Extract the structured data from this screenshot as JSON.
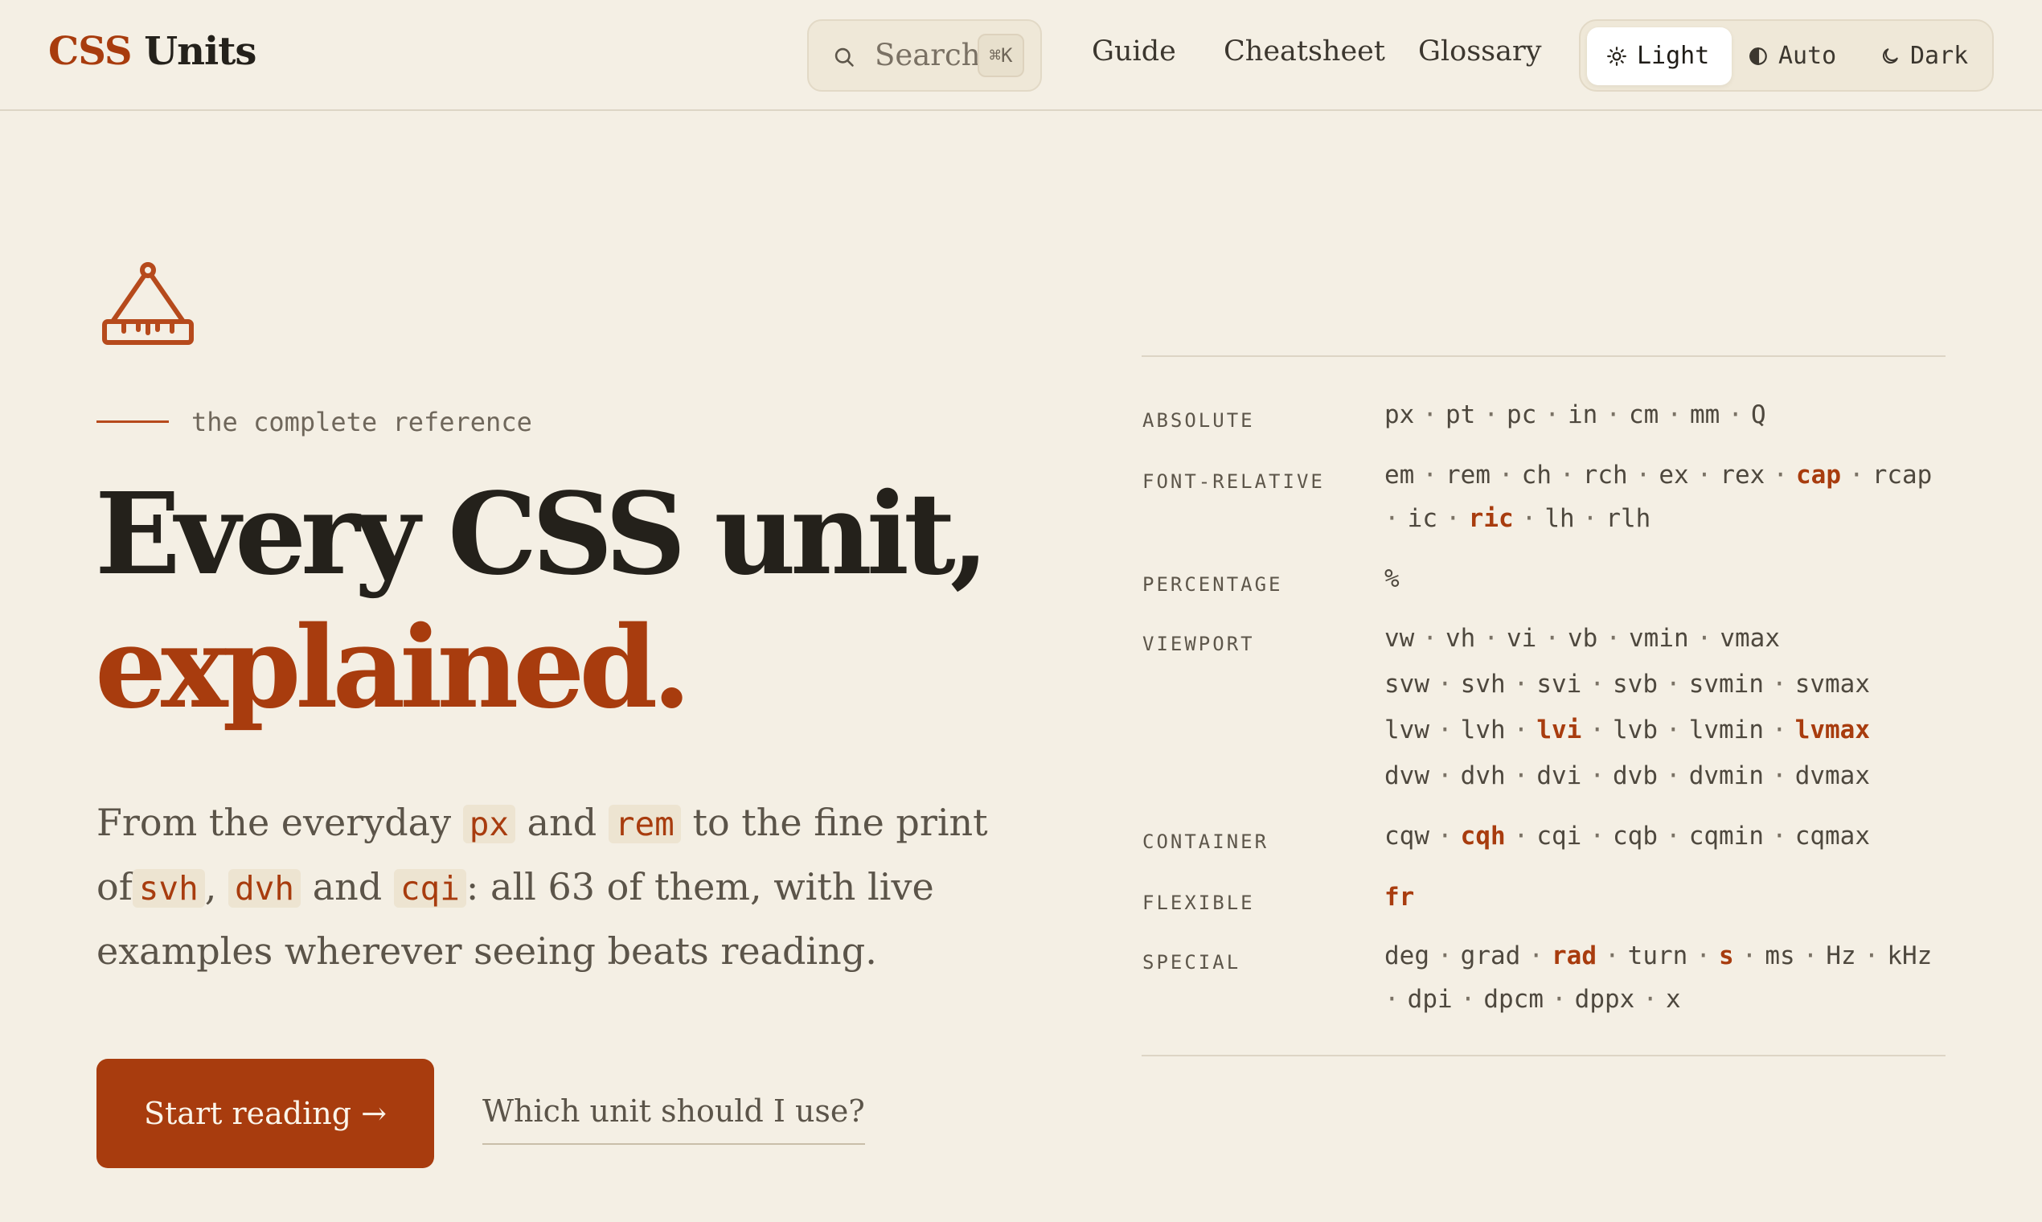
{
  "header": {
    "logo_accent": "CSS",
    "logo_rest": "Units",
    "search_label": "Search",
    "search_shortcut": "⌘K",
    "nav": [
      "Guide",
      "Cheatsheet",
      "Glossary"
    ],
    "theme": {
      "light": "Light",
      "auto": "Auto",
      "dark": "Dark",
      "selected": "Light"
    }
  },
  "hero": {
    "eyebrow": "the complete reference",
    "title_line1": "Every CSS unit,",
    "title_line2": "explained.",
    "lead": {
      "t1": "From the everyday ",
      "c1": "px",
      "t2": " and ",
      "c2": "rem",
      "t3": " to the fine print of",
      "c3": "svh",
      "t4": ", ",
      "c4": "dvh",
      "t5": " and ",
      "c5": "cqi",
      "t6": ": all 63 of them, with live examples wherever seeing beats reading."
    },
    "primary_button": "Start reading →",
    "secondary_link": "Which unit should I use?"
  },
  "colors": {
    "accent": "#a83c0e",
    "background": "#f4efe4",
    "text": "#24211b"
  },
  "reference": [
    {
      "category": "ABSOLUTE",
      "lines": [
        [
          "px",
          "pt",
          "pc",
          "in",
          "cm",
          "mm",
          "Q"
        ]
      ],
      "highlight": []
    },
    {
      "category": "FONT-RELATIVE",
      "lines": [
        [
          "em",
          "rem",
          "ch",
          "rch",
          "ex",
          "rex",
          "cap",
          "rcap"
        ],
        [
          "ic",
          "ric",
          "lh",
          "rlh"
        ]
      ],
      "highlight": [
        "cap",
        "ric"
      ]
    },
    {
      "category": "PERCENTAGE",
      "lines": [
        [
          "%"
        ]
      ],
      "highlight": []
    },
    {
      "category": "VIEWPORT",
      "lines": [
        [
          "vw",
          "vh",
          "vi",
          "vb",
          "vmin",
          "vmax"
        ],
        [
          "svw",
          "svh",
          "svi",
          "svb",
          "svmin",
          "svmax"
        ],
        [
          "lvw",
          "lvh",
          "lvi",
          "lvb",
          "lvmin",
          "lvmax"
        ],
        [
          "dvw",
          "dvh",
          "dvi",
          "dvb",
          "dvmin",
          "dvmax"
        ]
      ],
      "highlight": [
        "lvi",
        "lvmax"
      ]
    },
    {
      "category": "CONTAINER",
      "lines": [
        [
          "cqw",
          "cqh",
          "cqi",
          "cqb",
          "cqmin",
          "cqmax"
        ]
      ],
      "highlight": [
        "cqh"
      ]
    },
    {
      "category": "FLEXIBLE",
      "lines": [
        [
          "fr"
        ]
      ],
      "highlight": [
        "fr"
      ]
    },
    {
      "category": "SPECIAL",
      "lines": [
        [
          "deg",
          "grad",
          "rad",
          "turn",
          "s",
          "ms",
          "Hz",
          "kHz"
        ],
        [
          "dpi",
          "dpcm",
          "dppx",
          "x"
        ]
      ],
      "highlight": [
        "rad",
        "s"
      ]
    }
  ]
}
